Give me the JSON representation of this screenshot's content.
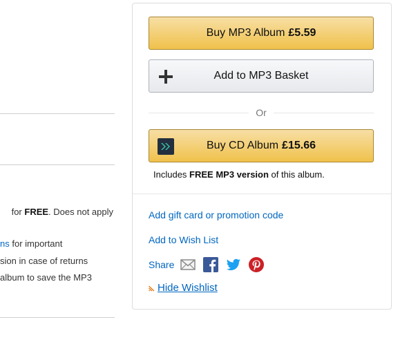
{
  "left": {
    "line1_prefix": "for ",
    "line1_bold": "FREE",
    "line1_suffix": ". Does not apply",
    "line2_link": "ns",
    "line2_rest": " for important",
    "line3": "sion in case of returns",
    "line4": "album to save the MP3"
  },
  "buybox": {
    "mp3_button": {
      "label": "Buy MP3 Album",
      "price": "£5.59"
    },
    "basket_button": {
      "label": "Add to MP3 Basket"
    },
    "or_label": "Or",
    "cd_button": {
      "label": "Buy CD Album",
      "price": "£15.66"
    },
    "includes": {
      "prefix": "Includes ",
      "bold": "FREE MP3 version",
      "suffix": " of this album."
    },
    "gift_card_link": "Add gift card or promotion code",
    "wish_list_link": "Add to Wish List",
    "share": {
      "label": "Share",
      "icons": [
        "email-icon",
        "facebook-icon",
        "twitter-icon",
        "pinterest-icon"
      ]
    },
    "hide_wishlist": "Hide Wishlist"
  },
  "colors": {
    "link": "#0066c0",
    "button_yellow": "#f0c14b",
    "facebook": "#3b5998",
    "twitter": "#1da1f2",
    "pinterest": "#cb2027"
  }
}
